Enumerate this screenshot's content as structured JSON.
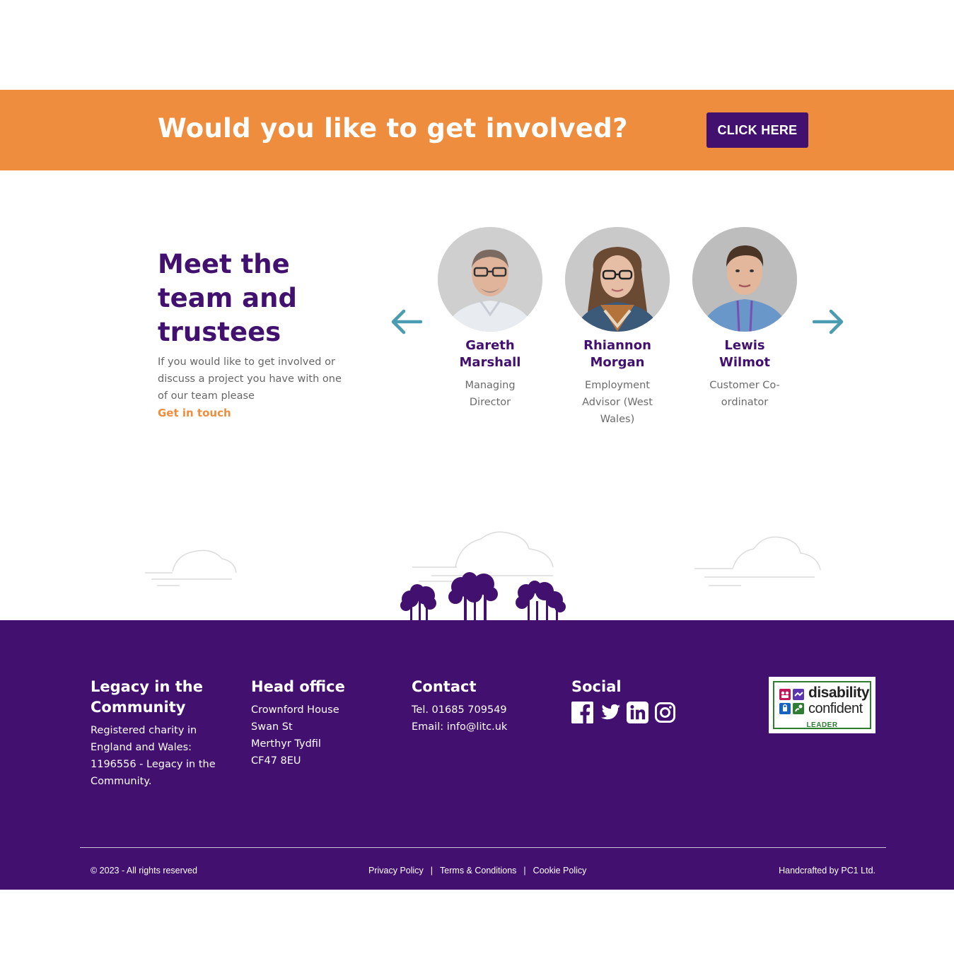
{
  "cta": {
    "title": "Would you like to get involved?",
    "button_label": "CLICK HERE"
  },
  "team": {
    "heading": "Meet the team and trustees",
    "text": "If you would like to get involved or discuss a project you have with one of our team please",
    "link_label": "Get in touch",
    "members": [
      {
        "name": "Gareth Marshall",
        "role": "Managing Director"
      },
      {
        "name": "Rhiannon Morgan",
        "role": "Employment Advisor (West Wales)"
      },
      {
        "name": "Lewis Wilmot",
        "role": "Customer Co-ordinator"
      }
    ]
  },
  "footer": {
    "org": {
      "title": "Legacy in the Community",
      "text": "Registered charity in England and Wales: 1196556 - Legacy in the Community."
    },
    "head_office": {
      "title": "Head office",
      "lines": [
        "Crownford House",
        "Swan St",
        "Merthyr Tydfil",
        "CF47 8EU"
      ]
    },
    "contact": {
      "title": "Contact",
      "tel": "Tel. 01685 709549",
      "email": "Email: info@litc.uk"
    },
    "social": {
      "title": "Social",
      "icons": [
        "facebook-icon",
        "twitter-icon",
        "linkedin-icon",
        "instagram-icon"
      ]
    },
    "badge": {
      "line1": "disability",
      "line2": "confident",
      "line3": "LEADER"
    },
    "copyright": "© 2023 - All rights reserved",
    "legal": {
      "privacy": "Privacy Policy",
      "sep": "|",
      "terms": "Terms & Conditions",
      "cookie": "Cookie Policy"
    },
    "credit": "Handcrafted by PC1 Ltd."
  },
  "colors": {
    "orange": "#ee8d3e",
    "purple": "#42106f",
    "teal": "#4a9db0"
  }
}
